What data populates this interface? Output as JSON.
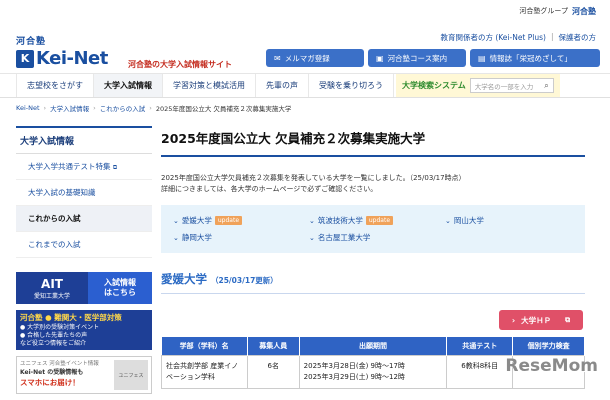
{
  "topbar": {
    "group_text": "河合塾グループ",
    "group_logo": "河合塾"
  },
  "logo": {
    "kawai": "河合塾",
    "box": "K",
    "main": "Kei-Net"
  },
  "tagline": "河合塾の大学入試情報サイト",
  "util_links": [
    "教育関係者の方 (Kei-Net Plus)",
    "保護者の方"
  ],
  "header_buttons": [
    {
      "icon": "mail-icon",
      "label": "メルマガ登録"
    },
    {
      "icon": "school-icon",
      "label": "河合塾コース案内"
    },
    {
      "icon": "book-icon",
      "label": "情報誌「栄冠めざして」"
    }
  ],
  "nav": {
    "items": [
      "志望校をさがす",
      "大学入試情報",
      "学習対策と模試活用",
      "先輩の声",
      "受験を乗り切ろう"
    ],
    "active_index": 1,
    "search_label": "大学検索システム",
    "search_placeholder": "大学名の一部を入力"
  },
  "breadcrumb": [
    "Kei-Net",
    "大学入試情報",
    "これからの入試",
    "2025年度国公立大 欠員補充２次募集実施大学"
  ],
  "sidebar": {
    "title": "大学入試情報",
    "items": [
      "大学入学共通テスト特集",
      "大学入試の基礎知識",
      "これからの入試",
      "これまでの入試"
    ],
    "active_index": 2
  },
  "banners": {
    "ait_big": "AIT",
    "ait_small": "愛知工業大学",
    "ait_right_1": "入試情報",
    "ait_right_2": "はこちら",
    "med_head": "河合塾 ● 難関大・医学部対策",
    "med_line1": "● 大学別の受験対策イベント",
    "med_line2": "● 合格した先輩たちの声",
    "med_line3": "など役立つ情報をご紹介",
    "juken_top": "ユニフェス 河合塾イベント情報",
    "juken_line1": "Kei-Net の受験情報も",
    "juken_line2": "スマホにお届け！",
    "juken_img": "ユニフェス"
  },
  "main": {
    "title": "2025年度国公立大 欠員補充２次募集実施大学",
    "intro_1": "2025年度国公立大学欠員補充２次募集を発表している大学を一覧にしました。（25/03/17時点）",
    "intro_2": "詳細につきましては、各大学のホームページで必ずご確認ください。",
    "universities": [
      {
        "name": "愛媛大学",
        "badge": "update"
      },
      {
        "name": "筑波技術大学",
        "badge": "update"
      },
      {
        "name": "岡山大学",
        "badge": ""
      },
      {
        "name": "静岡大学",
        "badge": ""
      },
      {
        "name": "名古屋工業大学",
        "badge": ""
      }
    ],
    "section_title": "愛媛大学",
    "section_updated": "（25/03/17更新）",
    "hp_button": "大学ＨＰ",
    "table": {
      "headers": [
        "学部（学科）名",
        "募集人員",
        "出願期間",
        "共通テスト",
        "個別学力検査"
      ],
      "rows": [
        {
          "dept": "社会共創学部 産業イノベーション学科",
          "capacity": "6名",
          "period_1": "2025年3月28日(金) 9時〜17時",
          "period_2": "2025年3月29日(土) 9時〜12時",
          "kyotsu": "6教科8科目",
          "kobetsu": ""
        }
      ]
    }
  },
  "watermark": "ReseMom"
}
